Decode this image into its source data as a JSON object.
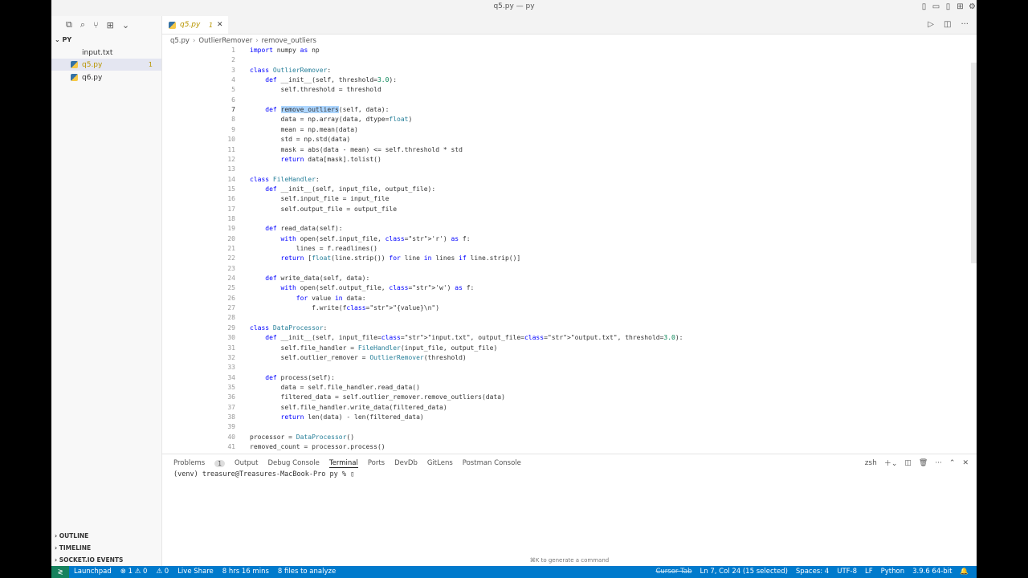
{
  "window": {
    "title": "q5.py — py"
  },
  "sidebar": {
    "folder": "PY",
    "files": [
      {
        "name": "input.txt",
        "badge": ""
      },
      {
        "name": "q5.py",
        "badge": "1"
      },
      {
        "name": "q6.py",
        "badge": ""
      }
    ],
    "sections": [
      "OUTLINE",
      "TIMELINE",
      "SOCKET.IO EVENTS"
    ]
  },
  "editor": {
    "tab": {
      "name": "q5.py",
      "modified": "1",
      "close": "✕"
    },
    "breadcrumb": [
      "q5.py",
      "OutlierRemover",
      "remove_outliers"
    ],
    "lines": [
      "import numpy as np",
      "",
      "class OutlierRemover:",
      "    def __init__(self, threshold=3.0):",
      "        self.threshold = threshold",
      "",
      "    def remove_outliers(self, data):",
      "        data = np.array(data, dtype=float)",
      "        mean = np.mean(data)",
      "        std = np.std(data)",
      "        mask = abs(data - mean) <= self.threshold * std",
      "        return data[mask].tolist()",
      "",
      "class FileHandler:",
      "    def __init__(self, input_file, output_file):",
      "        self.input_file = input_file",
      "        self.output_file = output_file",
      "",
      "    def read_data(self):",
      "        with open(self.input_file, 'r') as f:",
      "            lines = f.readlines()",
      "        return [float(line.strip()) for line in lines if line.strip()]",
      "",
      "    def write_data(self, data):",
      "        with open(self.output_file, 'w') as f:",
      "            for value in data:",
      "                f.write(f\"{value}\\n\")",
      "",
      "class DataProcessor:",
      "    def __init__(self, input_file=\"input.txt\", output_file=\"output.txt\", threshold=3.0):",
      "        self.file_handler = FileHandler(input_file, output_file)",
      "        self.outlier_remover = OutlierRemover(threshold)",
      "",
      "    def process(self):",
      "        data = self.file_handler.read_data()",
      "        filtered_data = self.outlier_remover.remove_outliers(data)",
      "        self.file_handler.write_data(filtered_data)",
      "        return len(data) - len(filtered_data)",
      "",
      "processor = DataProcessor()",
      "removed_count = processor.process()"
    ],
    "current_line": 7
  },
  "panel": {
    "tabs": [
      {
        "label": "Problems",
        "badge": "1"
      },
      {
        "label": "Output"
      },
      {
        "label": "Debug Console"
      },
      {
        "label": "Terminal",
        "active": true
      },
      {
        "label": "Ports"
      },
      {
        "label": "DevDb"
      },
      {
        "label": "GitLens"
      },
      {
        "label": "Postman Console"
      }
    ],
    "shell": "zsh",
    "prompt": "(venv) treasure@Treasures-MacBook-Pro py % ",
    "hint": "⌘K to generate a command"
  },
  "statusbar": {
    "left": [
      "Launchpad",
      "⊗ 1 ⚠ 0",
      "⚠ 0",
      "Live Share",
      "8 hrs 16 mins",
      "8 files to analyze"
    ],
    "cursor_tab": "Cursor Tab",
    "right": [
      "Ln 7, Col 24 (15 selected)",
      "Spaces: 4",
      "UTF-8",
      "LF",
      "Python",
      "3.9.6 64-bit"
    ]
  },
  "colors": {
    "accent": "#007acc",
    "remote": "#16825d",
    "modified": "#b89500"
  }
}
